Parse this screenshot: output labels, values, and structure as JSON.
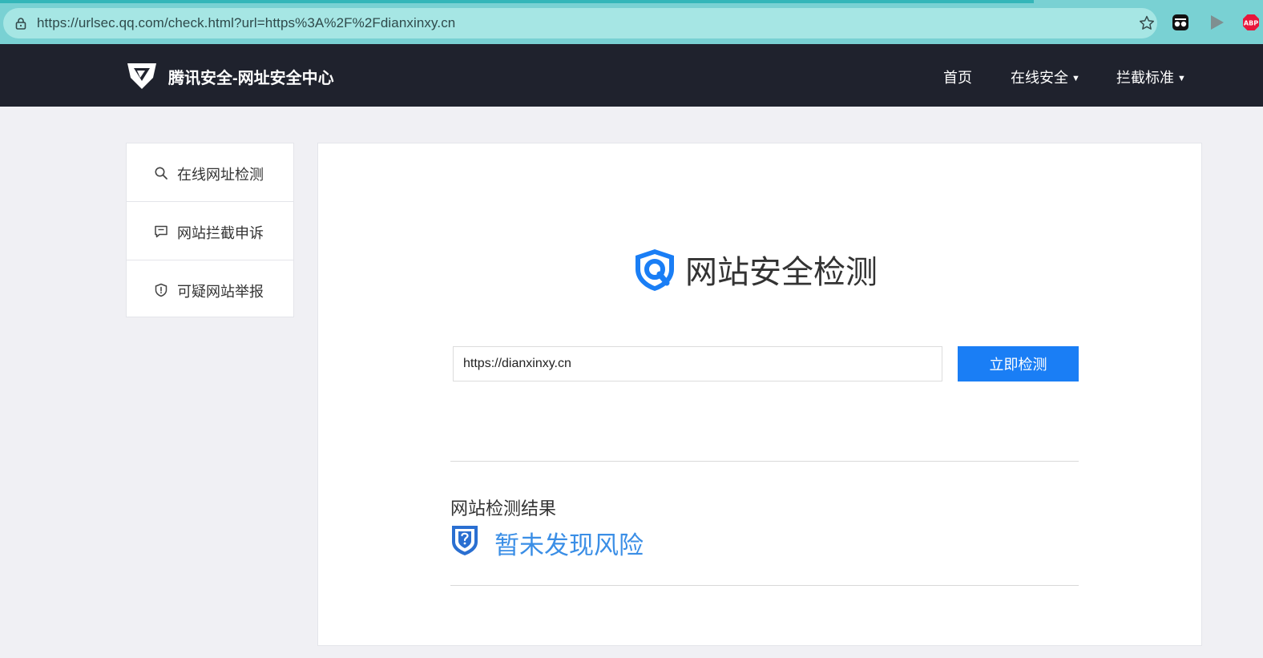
{
  "browser": {
    "url": "https://urlsec.qq.com/check.html?url=https%3A%2F%2Fdianxinxy.cn",
    "extensions": [
      "glasses-extension-icon",
      "play-extension-icon",
      "adblock-extension-icon"
    ],
    "adblock_badge": "ABP"
  },
  "header": {
    "brand_title": "腾讯安全-网址安全中心",
    "nav": [
      {
        "label": "首页",
        "has_dropdown": false
      },
      {
        "label": "在线安全",
        "has_dropdown": true
      },
      {
        "label": "拦截标准",
        "has_dropdown": true
      }
    ]
  },
  "sidebar": {
    "items": [
      {
        "label": "在线网址检测",
        "icon": "search-icon"
      },
      {
        "label": "网站拦截申诉",
        "icon": "message-icon"
      },
      {
        "label": "可疑网站举报",
        "icon": "shield-alert-icon"
      }
    ]
  },
  "main": {
    "title": "网站安全检测",
    "input_value": "https://dianxinxy.cn",
    "check_button": "立即检测",
    "result_heading": "网站检测结果",
    "result_text": "暂未发现风险"
  },
  "colors": {
    "header_bg": "#1f222d",
    "accent_blue": "#1a7ef5",
    "result_blue": "#3a8ee6",
    "browser_chrome": "#79d1d3"
  }
}
